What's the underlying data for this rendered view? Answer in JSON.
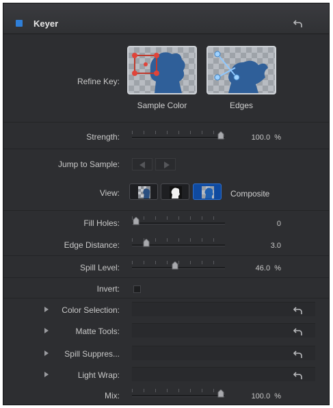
{
  "header": {
    "title": "Keyer",
    "accent_color": "#2f7fd8"
  },
  "refine_key": {
    "label": "Refine Key:",
    "sample_color_caption": "Sample Color",
    "edges_caption": "Edges"
  },
  "strength": {
    "label": "Strength:",
    "value": "100.0",
    "unit": "%",
    "fraction": 1.0
  },
  "jump_to_sample": {
    "label": "Jump to Sample:"
  },
  "view": {
    "label": "View:",
    "selected_label": "Composite",
    "selected_index": 2
  },
  "fill_holes": {
    "label": "Fill Holes:",
    "value": "0",
    "fraction": 0.0
  },
  "edge_distance": {
    "label": "Edge Distance:",
    "value": "3.0",
    "fraction": 0.12
  },
  "spill_level": {
    "label": "Spill Level:",
    "value": "46.0",
    "unit": "%",
    "fraction": 0.46
  },
  "invert": {
    "label": "Invert:",
    "checked": false
  },
  "groups": {
    "color_selection": {
      "label": "Color Selection:"
    },
    "matte_tools": {
      "label": "Matte Tools:"
    },
    "spill_suppression": {
      "label": "Spill Suppres..."
    },
    "light_wrap": {
      "label": "Light Wrap:"
    }
  },
  "mix": {
    "label": "Mix:",
    "value": "100.0",
    "unit": "%",
    "fraction": 1.0
  }
}
